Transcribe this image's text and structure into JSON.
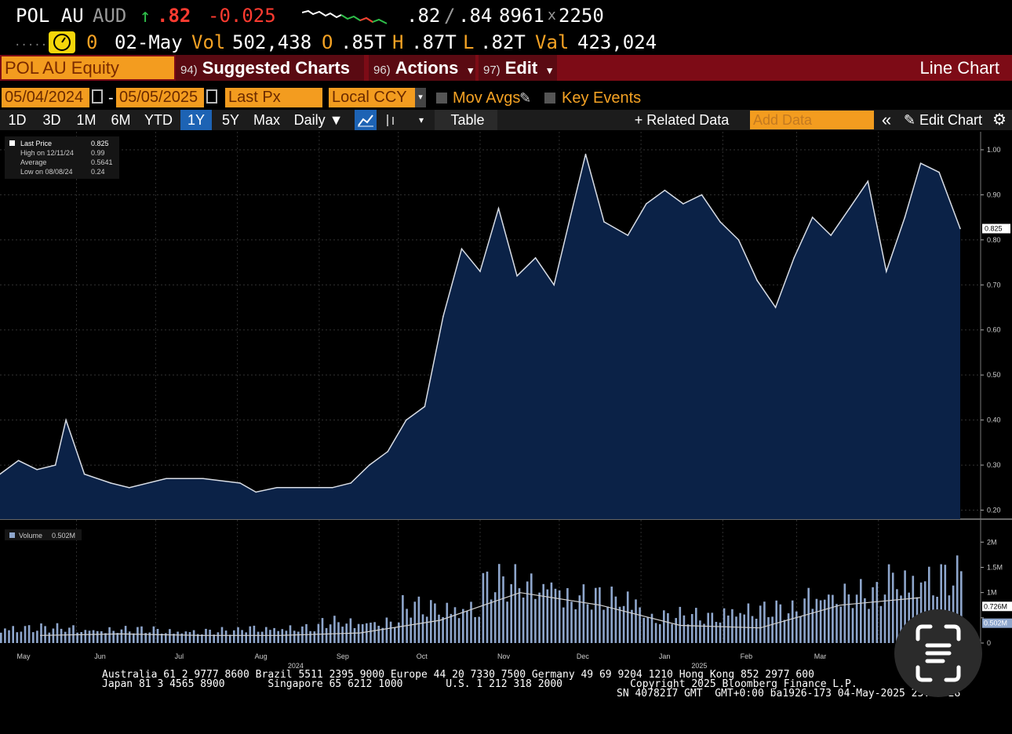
{
  "quote": {
    "ticker": "POL AU",
    "currency": "AUD",
    "arrow": "↑",
    "last": ".82",
    "change": "-0.025",
    "bid": ".82",
    "slash": "/",
    "ask": ".84",
    "bid_size": "8961",
    "times": "x",
    "ask_size": "2250",
    "dots": ".....",
    "alert_count": "0",
    "date": "02-May",
    "vol_label": "Vol",
    "volume": "502,438",
    "o_label": "O",
    "open": ".85T",
    "h_label": "H",
    "high": ".87T",
    "l_label": "L",
    "low": ".82T",
    "val_label": "Val",
    "value": "423,024"
  },
  "menubar": {
    "security": "POL AU Equity",
    "suggested_num": "94)",
    "suggested": "Suggested Charts",
    "actions_num": "96)",
    "actions": "Actions",
    "edit_num": "97)",
    "edit": "Edit",
    "chart_type": "Line Chart",
    "caret": "▾"
  },
  "fields": {
    "start_date": "05/04/2024",
    "dash": "-",
    "end_date": "05/05/2025",
    "field": "Last Px",
    "currency": "Local CCY",
    "mov_avgs": "Mov Avgs",
    "key_events": "Key Events"
  },
  "toolbar": {
    "periods": [
      "1D",
      "3D",
      "1M",
      "6M",
      "YTD",
      "1Y",
      "5Y",
      "Max"
    ],
    "active_period": "1Y",
    "frequency": "Daily ▼",
    "table": "Table",
    "related": "+ Related Data",
    "add_data_placeholder": "Add Data",
    "edit_chart": "Edit Chart",
    "collapse": "«"
  },
  "legend": {
    "last_price_label": "Last Price",
    "last_price": "0.825",
    "high_label": "High on 12/11/24",
    "high": "0.99",
    "avg_label": "Average",
    "avg": "0.5641",
    "low_label": "Low on 08/08/24",
    "low": "0.24",
    "volume_label": "Volume",
    "volume": "0.502M"
  },
  "colors": {
    "price_fill": "#0b2247",
    "price_line": "#d8dde6",
    "volume_bar": "#8ea6cc",
    "orange": "#f39c1f",
    "menubar": "#7d0b16"
  },
  "chart_data": {
    "type": "area",
    "price": {
      "x": [
        "2024-05-03",
        "2024-05-10",
        "2024-05-17",
        "2024-05-24",
        "2024-05-28",
        "2024-06-04",
        "2024-06-14",
        "2024-06-21",
        "2024-07-05",
        "2024-07-19",
        "2024-08-02",
        "2024-08-08",
        "2024-08-16",
        "2024-08-30",
        "2024-09-06",
        "2024-09-13",
        "2024-09-20",
        "2024-09-27",
        "2024-10-04",
        "2024-10-11",
        "2024-10-18",
        "2024-10-25",
        "2024-11-01",
        "2024-11-08",
        "2024-11-15",
        "2024-11-22",
        "2024-11-29",
        "2024-12-06",
        "2024-12-11",
        "2024-12-18",
        "2024-12-27",
        "2025-01-03",
        "2025-01-10",
        "2025-01-17",
        "2025-01-24",
        "2025-01-31",
        "2025-02-07",
        "2025-02-14",
        "2025-02-21",
        "2025-02-28",
        "2025-03-07",
        "2025-03-14",
        "2025-03-21",
        "2025-03-28",
        "2025-04-04",
        "2025-04-11",
        "2025-04-17",
        "2025-04-24",
        "2025-05-02"
      ],
      "values": [
        0.28,
        0.31,
        0.29,
        0.3,
        0.4,
        0.28,
        0.26,
        0.25,
        0.27,
        0.27,
        0.26,
        0.24,
        0.25,
        0.25,
        0.25,
        0.26,
        0.3,
        0.33,
        0.4,
        0.43,
        0.63,
        0.78,
        0.73,
        0.87,
        0.72,
        0.76,
        0.7,
        0.87,
        0.99,
        0.84,
        0.81,
        0.88,
        0.91,
        0.88,
        0.9,
        0.84,
        0.8,
        0.71,
        0.65,
        0.76,
        0.85,
        0.81,
        0.87,
        0.93,
        0.73,
        0.85,
        0.97,
        0.95,
        0.825
      ],
      "ylim": [
        0.18,
        1.04
      ],
      "yticks": [
        "1.00",
        "0.90",
        "0.80",
        "0.70",
        "0.60",
        "0.50",
        "0.40",
        "0.30",
        "0.20"
      ],
      "last_tag": "0.825"
    },
    "volume": {
      "unit": "M",
      "x": [
        "2024-05",
        "2024-06",
        "2024-07",
        "2024-08",
        "2024-09",
        "2024-10",
        "2024-11",
        "2024-12",
        "2025-01",
        "2025-02",
        "2025-03",
        "2025-04"
      ],
      "values": [
        0.25,
        0.22,
        0.2,
        0.25,
        0.35,
        0.6,
        1.0,
        0.75,
        0.45,
        0.55,
        0.8,
        1.1
      ],
      "avg_values": [
        0.15,
        0.18,
        0.15,
        0.15,
        0.2,
        0.45,
        1.0,
        0.75,
        0.35,
        0.3,
        0.75,
        0.9
      ],
      "yticks": [
        "2M",
        "1.5M",
        "1M",
        "0.5M",
        "0"
      ],
      "ylim": [
        0,
        2.3
      ],
      "last_tag": "0.502M",
      "avg_tag": "0.726M"
    },
    "x_labels": [
      "May",
      "Jun",
      "Jul",
      "Aug",
      "Sep",
      "Oct",
      "Nov",
      "Dec",
      "Jan",
      "Feb",
      "Mar",
      "Apr"
    ],
    "year_labels": [
      "2024",
      "2025"
    ]
  },
  "footer": {
    "line1": "Australia 61 2 9777 8600 Brazil 5511 2395 9000 Europe 44 20 7330 7500 Germany 49 69 9204 1210 Hong Kong 852 2977 600",
    "line2": "Japan 81 3 4565 8900       Singapore 65 6212 1000       U.S. 1 212 318 2000           Copyright 2025 Bloomberg Finance L.P.",
    "line3": "SN 4078217 GMT  GMT+0:00 ba1926-173 04-May-2025 23:23:28"
  }
}
